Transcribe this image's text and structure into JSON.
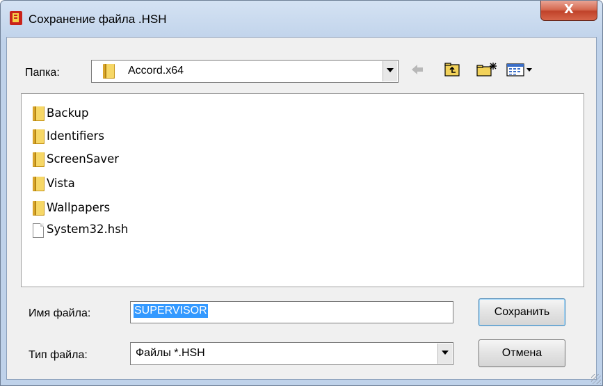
{
  "window": {
    "title": "Сохранение файла .HSH",
    "close_label": "X"
  },
  "location": {
    "label": "Папка:",
    "current_folder": "Accord.x64"
  },
  "toolbar": {
    "icons": [
      "back-arrow-icon",
      "up-folder-icon",
      "new-folder-icon",
      "view-menu-icon"
    ]
  },
  "files": [
    {
      "name": "Backup",
      "type": "folder"
    },
    {
      "name": "Identifiers",
      "type": "folder"
    },
    {
      "name": "ScreenSaver",
      "type": "folder"
    },
    {
      "name": "Vista",
      "type": "folder"
    },
    {
      "name": "Wallpapers",
      "type": "folder"
    },
    {
      "name": "System32.hsh",
      "type": "file"
    }
  ],
  "filename": {
    "label": "Имя файла:",
    "value": "SUPERVISOR"
  },
  "filetype": {
    "label": "Тип файла:",
    "value": "Файлы  *.HSH"
  },
  "buttons": {
    "save": "Сохранить",
    "cancel": "Отмена"
  },
  "colors": {
    "selection": "#3399ff",
    "close_button": "#c7452c",
    "title_gradient_top": "#d4e2f3"
  }
}
